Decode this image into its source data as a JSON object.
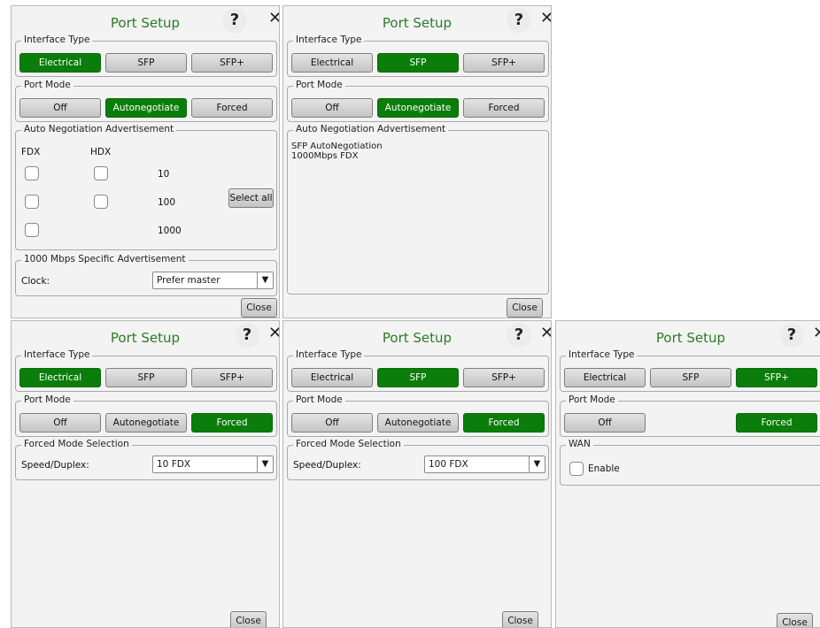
{
  "title": "Port Setup",
  "help_glyph": "?",
  "close_glyph": "✕",
  "interface_type_label": "Interface Type",
  "port_mode_label": "Port Mode",
  "interface_options": [
    "Electrical",
    "SFP",
    "SFP+"
  ],
  "port_mode_options": [
    "Off",
    "Autonegotiate",
    "Forced"
  ],
  "close_label": "Close",
  "panel1": {
    "interface_selected": "Electrical",
    "port_mode_selected": "Autonegotiate",
    "auto_neg": {
      "label": "Auto Negotiation Advertisement",
      "fdx_label": "FDX",
      "hdx_label": "HDX",
      "speeds": [
        "10",
        "100",
        "1000"
      ],
      "select_all_label": "Select all"
    },
    "specific": {
      "label": "1000 Mbps Specific Advertisement",
      "clock_label": "Clock:",
      "clock_value": "Prefer master"
    }
  },
  "panel2": {
    "interface_selected": "SFP",
    "port_mode_selected": "Autonegotiate",
    "auto_neg_label": "Auto Negotiation Advertisement",
    "line1": "SFP AutoNegotiation",
    "line2": "1000Mbps FDX"
  },
  "panel3": {
    "interface_selected": "Electrical",
    "port_mode_selected": "Forced",
    "forced_label": "Forced Mode Selection",
    "speed_label": "Speed/Duplex:",
    "speed_value": "10 FDX"
  },
  "panel4": {
    "interface_selected": "SFP",
    "port_mode_selected": "Forced",
    "forced_label": "Forced Mode Selection",
    "speed_label": "Speed/Duplex:",
    "speed_value": "100 FDX"
  },
  "panel5": {
    "interface_selected": "SFP+",
    "port_mode_selected": "Forced",
    "wan_label": "WAN",
    "enable_label": "Enable"
  },
  "colors": {
    "selected": "#0a7d0a",
    "title": "#2b7a2b"
  }
}
